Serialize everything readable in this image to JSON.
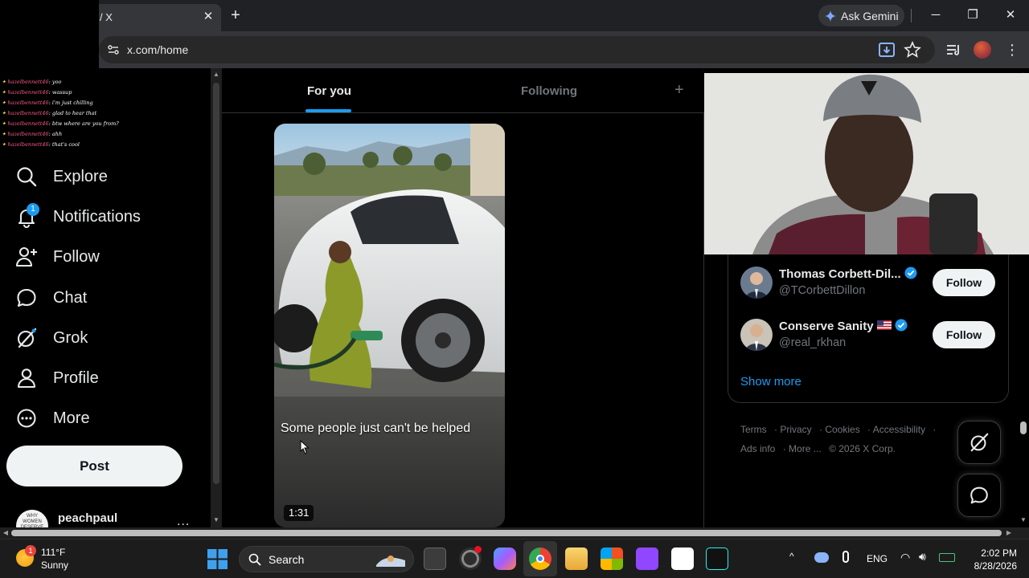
{
  "browser": {
    "tab_title": "/ X",
    "url": "x.com/home",
    "gemini_label": "Ask Gemini",
    "window_controls": [
      "minimize-icon",
      "restore-icon",
      "close-icon"
    ]
  },
  "chat_overlay": {
    "messages": [
      {
        "user": "hazelbennett46",
        "text": "yoo"
      },
      {
        "user": "hazelbennett46",
        "text": "wassup"
      },
      {
        "user": "hazelbennett46",
        "text": "i'm just chilling"
      },
      {
        "user": "hazelbennett46",
        "text": "glad to hear that"
      },
      {
        "user": "hazelbennett46",
        "text": "btw where are you from?"
      },
      {
        "user": "hazelbennett46",
        "text": "ahh"
      },
      {
        "user": "hazelbennett46",
        "text": "that's cool"
      }
    ]
  },
  "sidebar": {
    "items": [
      {
        "label": "Explore",
        "icon": "search-icon"
      },
      {
        "label": "Notifications",
        "icon": "bell-icon",
        "badge": "1"
      },
      {
        "label": "Follow",
        "icon": "person-add-icon"
      },
      {
        "label": "Chat",
        "icon": "chat-bubble-icon"
      },
      {
        "label": "Grok",
        "icon": "grok-icon"
      },
      {
        "label": "Profile",
        "icon": "person-icon"
      },
      {
        "label": "More",
        "icon": "more-circle-icon"
      }
    ],
    "post_label": "Post",
    "account_name": "peachpaul",
    "account_more": "..."
  },
  "feed": {
    "tabs": [
      "For you",
      "Following"
    ],
    "active_tab": "For you",
    "add_tab": "+",
    "video": {
      "caption": "Some people just can't be helped",
      "duration": "1:31"
    }
  },
  "who_to_follow": {
    "accounts": [
      {
        "name": "Thomas Corbett-Dil...",
        "handle": "@TCorbettDillon",
        "verified": true,
        "button": "Follow"
      },
      {
        "name": "Conserve Sanity",
        "handle": "@real_rkhan",
        "verified": true,
        "flag": "us-flag-icon",
        "button": "Follow"
      }
    ],
    "show_more": "Show more"
  },
  "footer": {
    "links": [
      "Terms",
      "Privacy",
      "Cookies",
      "Accessibility",
      "Ads info",
      "More ...",
      "© 2026 X Corp."
    ]
  },
  "taskbar": {
    "weather_temp": "111°F",
    "weather_desc": "Sunny",
    "weather_badge": "1",
    "search_label": "Search",
    "language": "ENG",
    "time": "2:02 PM",
    "date": "8/28/2026"
  },
  "colors": {
    "accent": "#1d9bf0",
    "background": "#000000",
    "text_primary": "#e7e9ea",
    "text_secondary": "#71767b"
  }
}
